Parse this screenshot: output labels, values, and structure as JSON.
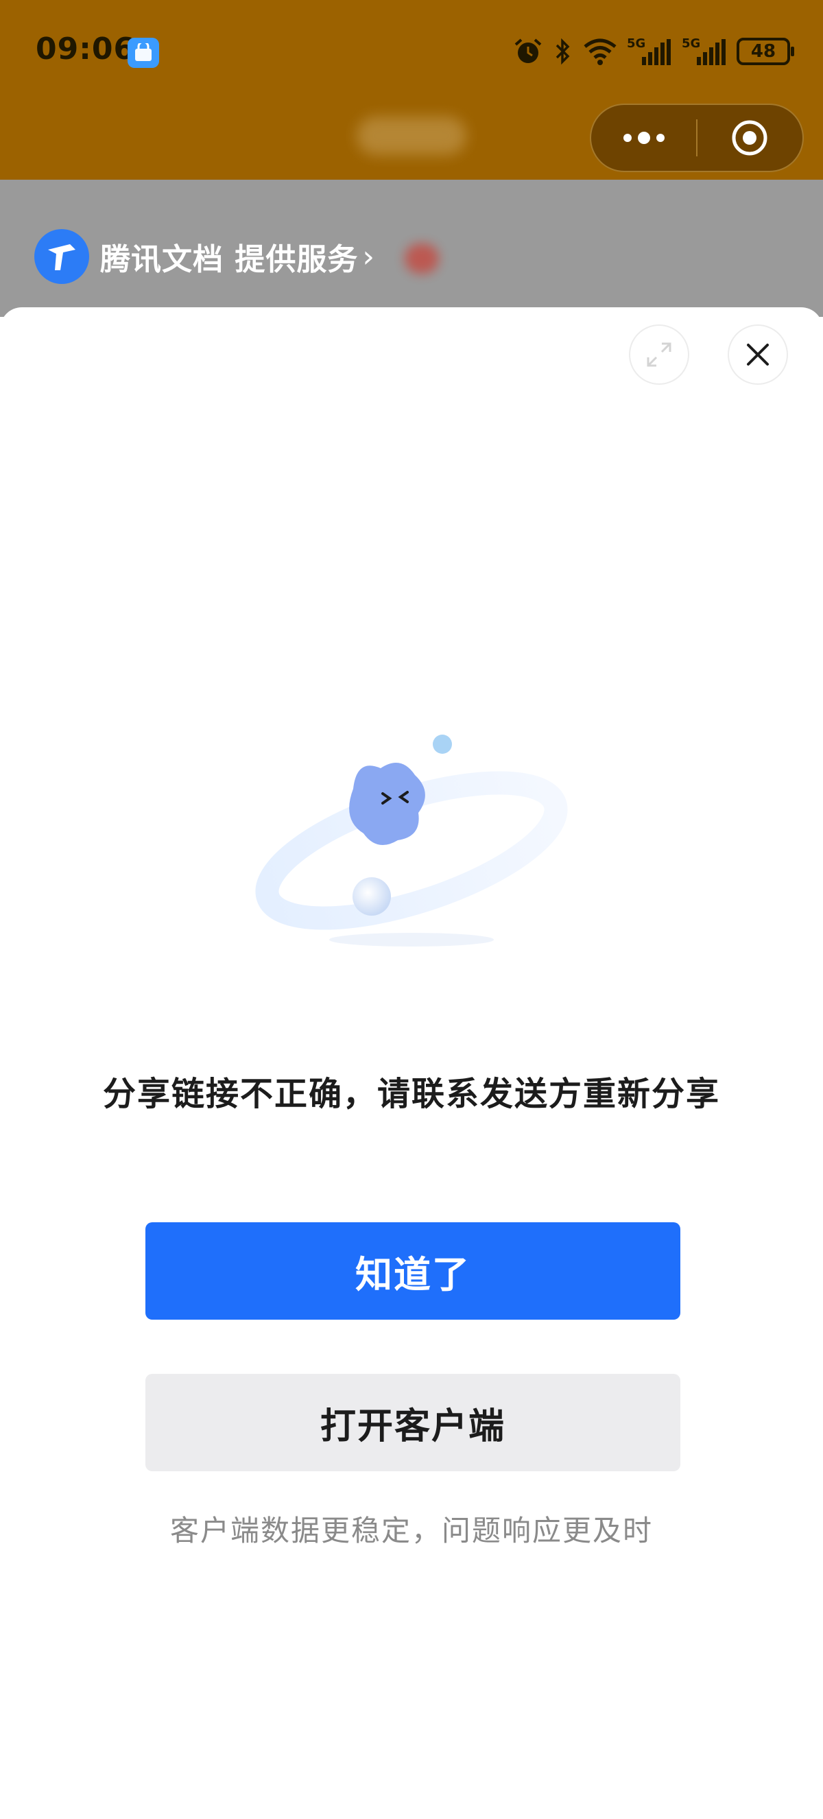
{
  "status_bar": {
    "time": "09:06",
    "app_badge_icon": "app-store-icon",
    "icons": [
      "alarm-icon",
      "bluetooth-icon",
      "wifi-icon",
      "signal-5g-icon",
      "signal-5g-icon"
    ],
    "signal_label_1": "5G",
    "signal_label_2": "5G",
    "battery": "48"
  },
  "capsule": {
    "more_icon": "more-dots-icon",
    "close_icon": "target-close-icon"
  },
  "provider": {
    "logo_icon": "tencent-docs-logo-icon",
    "text": "腾讯文档 提供服务",
    "chevron": "›"
  },
  "sheet": {
    "expand_icon": "expand-icon",
    "close_icon": "close-icon",
    "illustration_icon": "error-mascot-icon",
    "message": "分享链接不正确，请联系发送方重新分享",
    "primary_button": "知道了",
    "secondary_button": "打开客户端",
    "hint": "客户端数据更稳定，问题响应更及时"
  },
  "colors": {
    "header_bg": "#9c6200",
    "primary": "#1f6ffb",
    "secondary_bg": "#ececee",
    "hint_text": "#8a8a8a"
  }
}
